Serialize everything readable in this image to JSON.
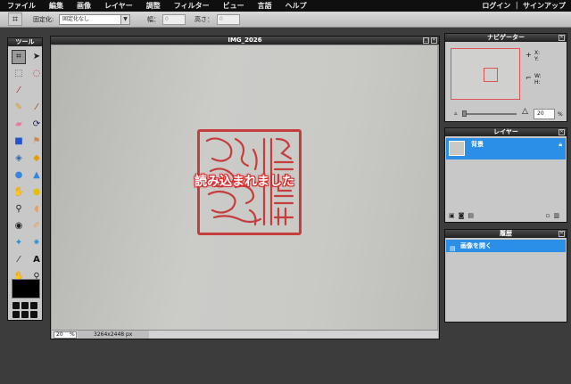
{
  "menubar": {
    "items": [
      "ファイル",
      "編集",
      "画像",
      "レイヤー",
      "調整",
      "フィルター",
      "ビュー",
      "言語",
      "ヘルプ"
    ],
    "right": "ログイン ｜ サインアップ"
  },
  "options": {
    "fixed_label": "固定化:",
    "fixed_value": "固定化なし",
    "width_label": "幅：",
    "width_value": "0",
    "height_label": "高さ：",
    "height_value": "0"
  },
  "tools": {
    "title": "ツール"
  },
  "document": {
    "title": "IMG_2026",
    "loading_text": "読み込まれました",
    "zoom": "20",
    "zoom_unit": "%",
    "dimensions": "3264x2448 px"
  },
  "navigator": {
    "title": "ナビゲーター",
    "x_label": "X:",
    "y_label": "Y:",
    "w_label": "W:",
    "h_label": "H:",
    "zoom": "20",
    "zoom_unit": "%"
  },
  "layers": {
    "title": "レイヤー",
    "items": [
      {
        "name": "背景"
      }
    ]
  },
  "history": {
    "title": "履歴",
    "items": [
      {
        "label": "画像を開く"
      }
    ]
  },
  "colors": {
    "accent": "#2b8fe8",
    "stamp": "#c63d3d",
    "loading_glow": "#dd3333"
  }
}
